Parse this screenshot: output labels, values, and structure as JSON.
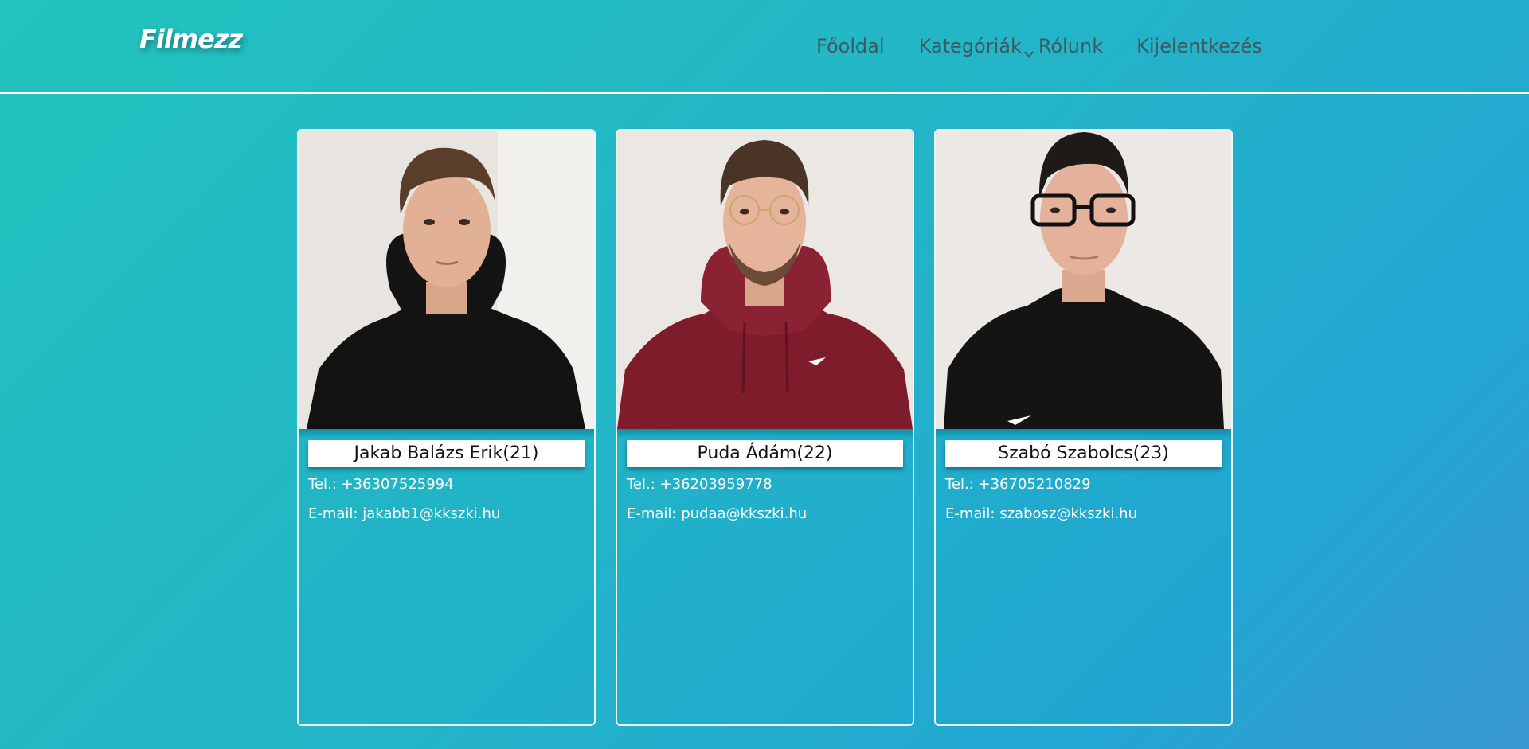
{
  "header": {
    "logo": "Filmezz",
    "nav": [
      {
        "label": "Főoldal"
      },
      {
        "label": "Kategóriák",
        "icon": "chevron-down-icon"
      },
      {
        "label": "Rólunk"
      },
      {
        "label": "Kijelentkezés"
      }
    ]
  },
  "members": [
    {
      "name": "Jakab Balázs Erik(21)",
      "tel": "Tel.: +36307525994",
      "email": "E-mail: jakabb1@kkszki.hu",
      "hoodie_color": "#121212",
      "hair_color": "#5a3e2b"
    },
    {
      "name": "Puda Ádám(22)",
      "tel": "Tel.: +36203959778",
      "email": "E-mail: pudaa@kkszki.hu",
      "hoodie_color": "#7e1c2c",
      "hair_color": "#4a3426"
    },
    {
      "name": "Szabó Szabolcs(23)",
      "tel": "Tel.: +36705210829",
      "email": "E-mail: szabosz@kkszki.hu",
      "hoodie_color": "#141414",
      "hair_color": "#1e1a18"
    }
  ],
  "colors": {
    "background_start": "#22c2bd",
    "background_end": "#22a6d3",
    "nav_text": "#3c5a60",
    "card_border": "#eef8fa"
  }
}
